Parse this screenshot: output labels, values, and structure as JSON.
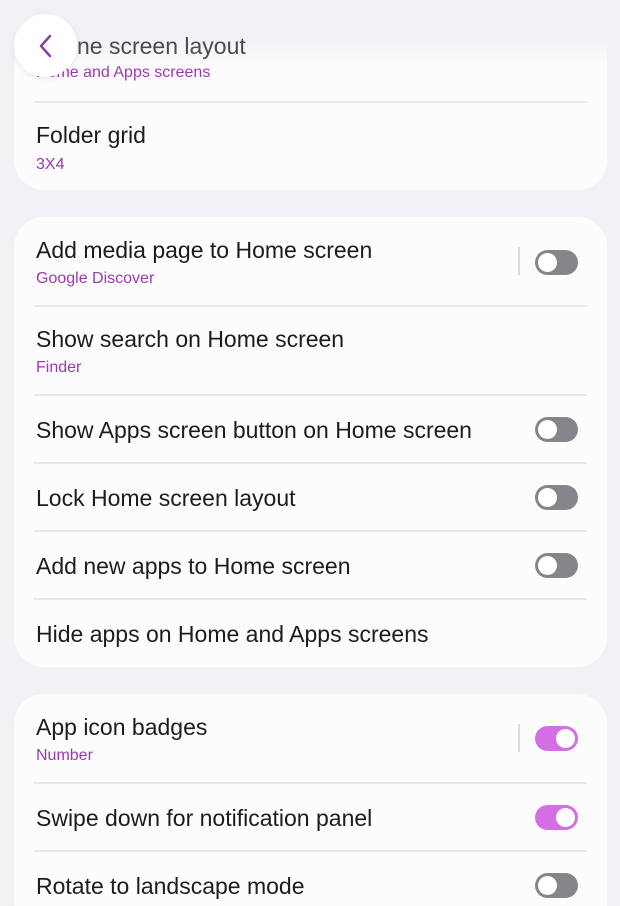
{
  "header": {
    "title": "ne screen layout",
    "back_icon": "chevron-left-icon"
  },
  "colors": {
    "accent": "#9a3aad",
    "toggle_on": "#d46ee5",
    "toggle_off": "#878589"
  },
  "section1": {
    "partial_subtitle": "Home and Apps screens",
    "folder_grid": {
      "title": "Folder grid",
      "value": "3X4"
    }
  },
  "section2": {
    "media_page": {
      "title": "Add media page to Home screen",
      "value": "Google Discover",
      "toggle": false
    },
    "search": {
      "title": "Show search on Home screen",
      "value": "Finder"
    },
    "apps_button": {
      "title": "Show Apps screen button on Home screen",
      "toggle": false
    },
    "lock_layout": {
      "title": "Lock Home screen layout",
      "toggle": false
    },
    "add_new_apps": {
      "title": "Add new apps to Home screen",
      "toggle": false
    },
    "hide_apps": {
      "title": "Hide apps on Home and Apps screens"
    }
  },
  "section3": {
    "badges": {
      "title": "App icon badges",
      "value": "Number",
      "toggle": true
    },
    "swipe_down": {
      "title": "Swipe down for notification panel",
      "toggle": true
    },
    "rotate": {
      "title": "Rotate to landscape mode",
      "toggle": false
    }
  }
}
